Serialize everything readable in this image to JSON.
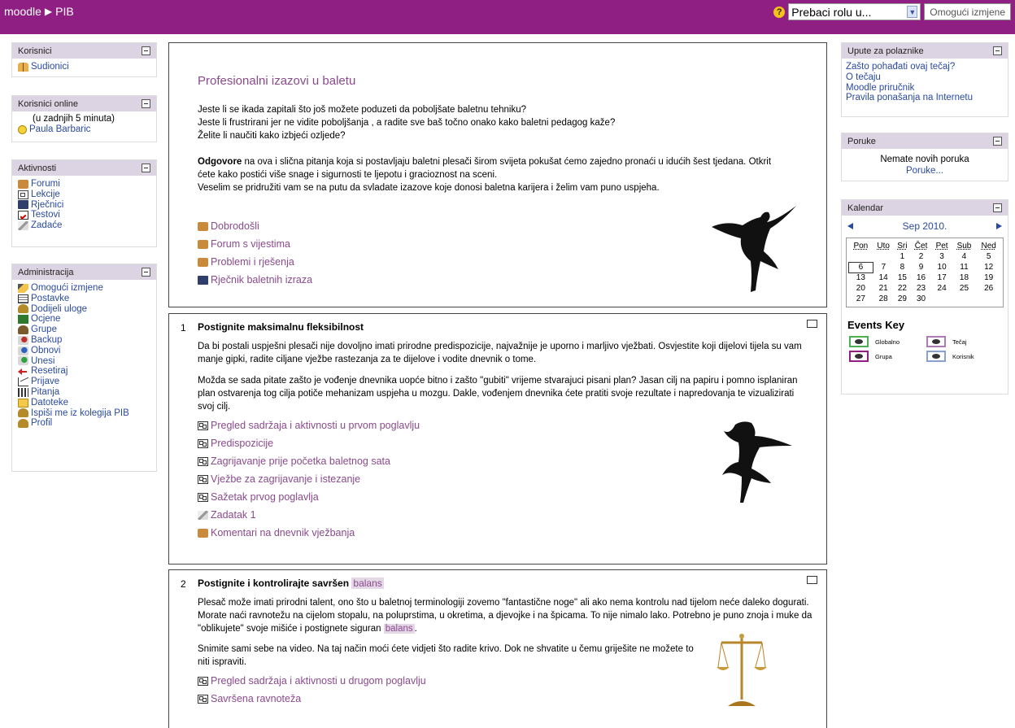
{
  "topbar": {
    "site": "moodle",
    "course": "PIB",
    "role_select": "Prebaci rolu u...",
    "edit_button": "Omogući izmjene"
  },
  "left": {
    "users": {
      "title": "Korisnici",
      "items": [
        "Sudionici"
      ]
    },
    "online": {
      "title": "Korisnici online",
      "note": "(u zadnjih 5 minuta)",
      "user": "Paula Barbaric"
    },
    "activities": {
      "title": "Aktivnosti",
      "items": [
        "Forumi",
        "Lekcije",
        "Rječnici",
        "Testovi",
        "Zadaće"
      ]
    },
    "admin": {
      "title": "Administracija",
      "items": [
        "Omogući izmjene",
        "Postavke",
        "Dodijeli uloge",
        "Ocjene",
        "Grupe",
        "Backup",
        "Obnovi",
        "Unesi",
        "Resetiraj",
        "Prijave",
        "Pitanja",
        "Datoteke",
        "Ispiši me iz kolegija PIB",
        "Profil"
      ]
    }
  },
  "center": {
    "intro": {
      "title": "Profesionalni izazovi u baletu",
      "line1": "Jeste li se ikada zapitali što još možete poduzeti da poboljšate baletnu tehniku?",
      "line2": "Jeste li frustrirani jer ne vidite poboljšanja , a radite sve baš točno onako kako baletni pedagog kaže?",
      "line3": "Želite li naučiti kako izbjeći ozljede?",
      "bold": "Odgovore",
      "p2": " na ova i slična pitanja koja si postavljaju baletni plesači širom svijeta pokušat ćemo zajedno pronaći u idućih šest tjedana. Otkrit ćete kako postići više snage i sigurnosti te ljepotu i gracioznost na sceni.",
      "p3": "Veselim se pridružiti vam se na putu da svladate izazove koje donosi baletna karijera i želim vam puno uspjeha.",
      "links": [
        "Dobrodošli",
        "Forum s vijestima",
        "Problemi i rješenja",
        "Rječnik baletnih izraza"
      ]
    },
    "s1": {
      "num": "1",
      "title": "Postignite maksimalnu fleksibilnost",
      "p1": "Da bi postali uspješni plesači nije dovoljno imati prirodne predispozicije, najvažnije je uporno i marljivo vježbati. Osvjestite koji dijelovi tijela su vam manje gipki, radite ciljane vježbe rastezanja za te dijelove i vodite dnevnik o tome.",
      "p2": "Možda se sada pitate zašto je vođenje dnevnika uopće bitno i zašto \"gubiti\" vrijeme stvarajuci pisani plan? Jasan cilj na papiru i pomno isplaniran plan ostvarenja tog cilja potiče mehanizam uspjeha u mozgu. Dakle, vođenjem dnevnika ćete pratiti svoje rezultate i napredovanja te vizualizirati svoj cilj.",
      "links": [
        "Pregled sadržaja i aktivnosti u prvom poglavlju",
        "Predispozicije",
        "Zagrijavanje prije početka baletnog sata",
        "Vježbe za zagrijavanje i istezanje",
        "Sažetak prvog poglavlja",
        "Zadatak 1",
        "Komentari na dnevnik vježbanja"
      ]
    },
    "s2": {
      "num": "2",
      "title": "Postignite i kontrolirajte savršen",
      "title_hl": "balans",
      "p1": "Plesač može imati prirodni talent, ono što u baletnoj terminologiji zovemo \"fantastične noge\" ali ako nema kontrolu nad tijelom neće daleko dogurati. Morate naći ravnotežu na cijelom stopalu, na poluprstima, u okretima, a djevojke i na špicama. To nije nimalo lako. Potrebno je puno znoja i muke da \"oblikujete\" svoje mišiće i postignete siguran",
      "p1_hl": "balans",
      "p1_end": ".",
      "p2": "Snimite sami sebe na video. Na taj način moći ćete vidjeti što radite krivo. Dok ne shvatite u čemu griješite ne možete to niti ispraviti.",
      "links": [
        "Pregled sadržaja i aktivnosti u drugom poglavlju",
        "Savršena ravnoteža"
      ]
    }
  },
  "right": {
    "guide": {
      "title": "Upute za polaznike",
      "items": [
        "Zašto pohađati ovaj tečaj?",
        "O tečaju",
        "Moodle priručnik",
        "Pravila ponašanja na Internetu"
      ]
    },
    "messages": {
      "title": "Poruke",
      "none": "Nemate novih poruka",
      "link": "Poruke..."
    },
    "calendar": {
      "title": "Kalendar",
      "month": "Sep 2010.",
      "days": [
        "Pon",
        "Uto",
        "Sri",
        "Čet",
        "Pet",
        "Sub",
        "Ned"
      ],
      "weeks": [
        [
          "",
          "",
          "1",
          "2",
          "3",
          "4",
          "5"
        ],
        [
          "6",
          "7",
          "8",
          "9",
          "10",
          "11",
          "12"
        ],
        [
          "13",
          "14",
          "15",
          "16",
          "17",
          "18",
          "19"
        ],
        [
          "20",
          "21",
          "22",
          "23",
          "24",
          "25",
          "26"
        ],
        [
          "27",
          "28",
          "29",
          "30",
          "",
          "",
          ""
        ]
      ],
      "today": "6"
    },
    "events": {
      "title": "Events Key",
      "global": "Globalno",
      "course": "Tečaj",
      "group": "Grupa",
      "user": "Korisnik"
    }
  },
  "colors": {
    "topbar": "#8f1f82",
    "link": "#8a4a8c",
    "block_header": "#dcd3e3"
  }
}
